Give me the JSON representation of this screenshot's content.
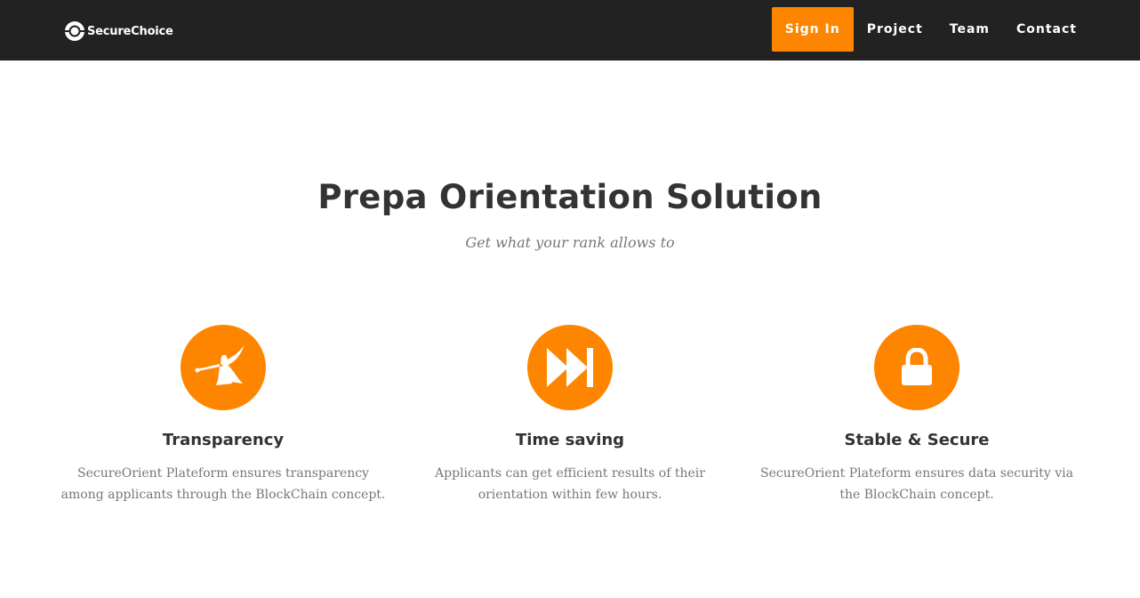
{
  "brand": {
    "name": "SecureChoice",
    "logo_icon": "ring-logo-icon"
  },
  "nav": {
    "items": [
      {
        "label": "Sign In",
        "active": true
      },
      {
        "label": "Project"
      },
      {
        "label": "Team"
      },
      {
        "label": "Contact"
      }
    ]
  },
  "hero": {
    "title": "Prepa Orientation Solution",
    "subtitle": "Get what your rank allows to"
  },
  "features": [
    {
      "icon": "herald-trumpet-icon",
      "title": "Transparency",
      "text": "SecureOrient Plateform ensures transparency among applicants through the BlockChain concept."
    },
    {
      "icon": "fast-forward-icon",
      "title": "Time saving",
      "text": "Applicants can get efficient results of their orientation within few hours."
    },
    {
      "icon": "lock-icon",
      "title": "Stable & Secure",
      "text": "SecureOrient Plateform ensures data security via the BlockChain concept."
    }
  ],
  "colors": {
    "accent": "#fe8500",
    "navbar": "#222222",
    "heading": "#333333",
    "muted": "#777777"
  }
}
